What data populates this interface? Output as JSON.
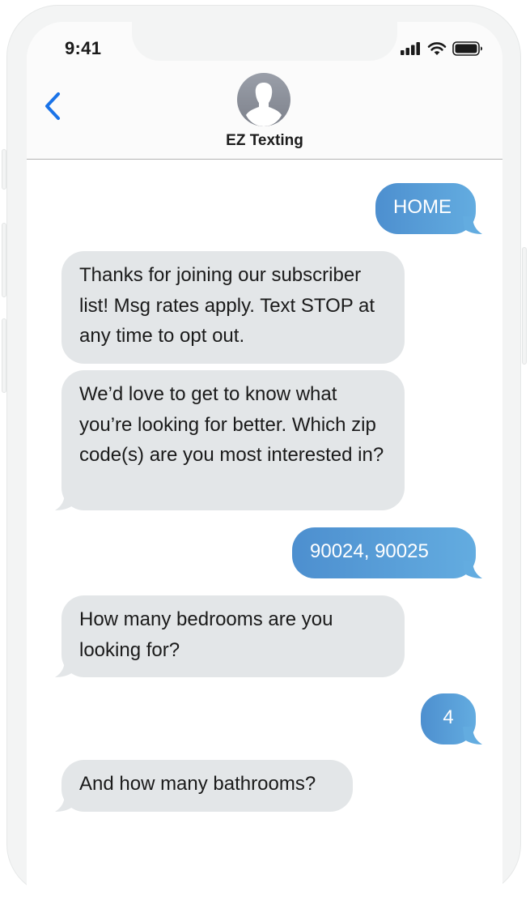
{
  "status_bar": {
    "time": "9:41",
    "icons": [
      "cellular-signal-icon",
      "wifi-icon",
      "battery-icon"
    ]
  },
  "header": {
    "back_icon": "chevron-left-icon",
    "avatar_icon": "person-silhouette-icon",
    "contact_name": "EZ Texting"
  },
  "colors": {
    "accent": "#1a73e8",
    "outgoing_bubble_start": "#4d8fcf",
    "outgoing_bubble_end": "#63ace0",
    "incoming_bubble": "#e3e6e8"
  },
  "messages": [
    {
      "direction": "outgoing",
      "text": "HOME"
    },
    {
      "direction": "incoming",
      "text": "Thanks for joining our subscriber list! Msg rates apply. Text STOP at any time to opt out."
    },
    {
      "direction": "incoming",
      "text": "We’d love to get to know what you’re looking for better. Which zip code(s) are you most interested in?"
    },
    {
      "direction": "outgoing",
      "text": "90024, 90025"
    },
    {
      "direction": "incoming",
      "text": "How many bedrooms are you looking for?"
    },
    {
      "direction": "outgoing",
      "text": "4"
    },
    {
      "direction": "incoming",
      "text": "And how many bathrooms?"
    }
  ]
}
